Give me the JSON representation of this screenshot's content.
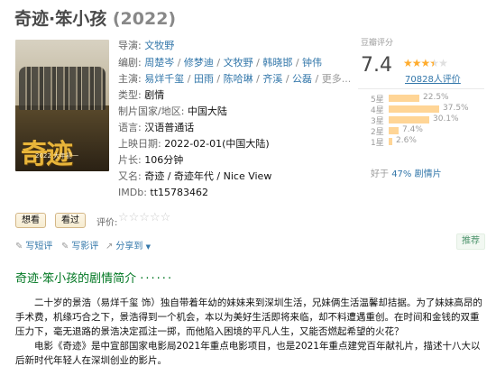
{
  "movie": {
    "title": "奇迹·笨小孩",
    "year": "(2022)"
  },
  "poster": {
    "title_text": "奇迹",
    "date_text": "2022 大年初一"
  },
  "info": {
    "director_label": "导演:",
    "director": "文牧野",
    "writer_label": "编剧:",
    "writers": [
      "周楚岑",
      "修梦迪",
      "文牧野",
      "韩晓邯",
      "钟伟"
    ],
    "cast_label": "主演:",
    "cast": [
      "易烊千玺",
      "田雨",
      "陈哈琳",
      "齐溪",
      "公磊"
    ],
    "cast_more": "更多...",
    "genre_label": "类型:",
    "genre": "剧情",
    "country_label": "制片国家/地区:",
    "country": "中国大陆",
    "language_label": "语言:",
    "language": "汉语普通话",
    "release_label": "上映日期:",
    "release": "2022-02-01(中国大陆)",
    "runtime_label": "片长:",
    "runtime": "106分钟",
    "aka_label": "又名:",
    "aka": "奇迹 / 奇迹年代 / Nice View",
    "imdb_label": "IMDb:",
    "imdb": "tt15783462"
  },
  "rating": {
    "label": "豆瓣评分",
    "score": "7.4",
    "stars_filled": 3.5,
    "votes": "70828人评价",
    "distribution": [
      {
        "star": "5星",
        "percent": "22.5%",
        "value": 22.5
      },
      {
        "star": "4星",
        "percent": "37.5%",
        "value": 37.5
      },
      {
        "star": "3星",
        "percent": "30.1%",
        "value": 30.1
      },
      {
        "star": "2星",
        "percent": "7.4%",
        "value": 7.4
      },
      {
        "star": "1星",
        "percent": "2.6%",
        "value": 2.6
      }
    ],
    "better_than_prefix": "好于",
    "better_than_value": "47%",
    "better_than_suffix": "剧情片"
  },
  "user_actions": {
    "want_label": "想看",
    "seen_label": "看过",
    "rate_label": "评价:",
    "rate_stars": "☆☆☆☆☆",
    "write_short": "写短评",
    "write_review": "写影评",
    "share": "分享到",
    "share_caret": "▼",
    "recommend": "推荐"
  },
  "intro": {
    "title": "奇迹·笨小孩的剧情简介",
    "title_dots": "······",
    "paragraph1": "二十岁的景浩（易烊千玺 饰）独自带着年幼的妹妹来到深圳生活，兄妹俩生活温馨却拮据。为了妹妹高昂的手术费，机缘巧合之下，景浩得到一个机会，本以为美好生活即将来临，却不料遭遇重创。在时间和金钱的双重压力下，毫无退路的景浩决定孤注一掷，而他陷入困境的平凡人生，又能否燃起希望的火花？",
    "paragraph2": "电影《奇迹》是中宣部国家电影局2021年重点电影项目，也是2021年重点建党百年献礼片，描述十八大以后新时代年轻人在深圳创业的影片。"
  },
  "colors": {
    "link": "#3377aa",
    "intro_title": "#007722",
    "star": "#ffac2d",
    "bar": "#ffd596"
  }
}
